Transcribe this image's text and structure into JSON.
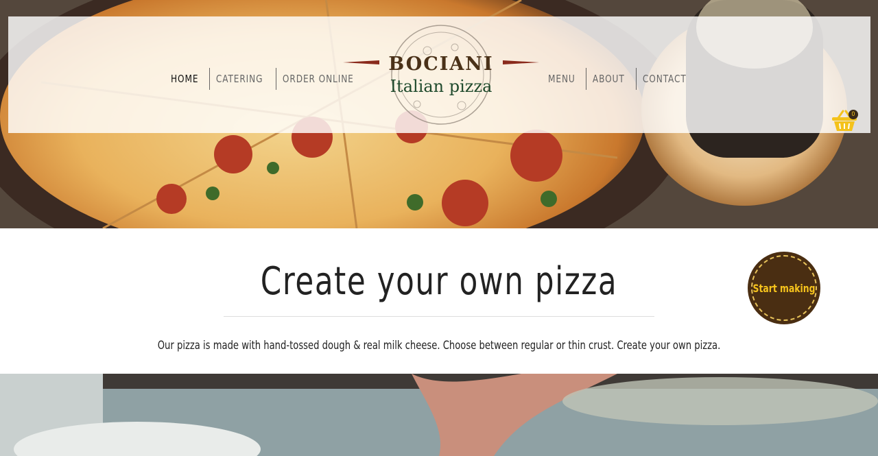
{
  "nav": {
    "left": [
      {
        "label": "HOME"
      },
      {
        "label": "CATERING"
      },
      {
        "label": "ORDER ONLINE"
      }
    ],
    "right": [
      {
        "label": "MENU"
      },
      {
        "label": "ABOUT"
      },
      {
        "label": "CONTACT"
      }
    ]
  },
  "logo": {
    "brand": "BOCIANI",
    "subtitle": "Italian pizza"
  },
  "cart": {
    "count": "0",
    "icon": "basket-icon",
    "color": "#f4c21b"
  },
  "intro": {
    "title": "Create your own pizza",
    "text": "Our pizza is made with hand-tossed dough & real milk cheese. Choose between regular or thin crust. Create your own pizza.",
    "cta": "Start making"
  },
  "colors": {
    "brand_brown": "#4a3118",
    "brand_green": "#1f4a2c",
    "cta_bg": "#4a2e12",
    "cta_text": "#f6c31c"
  }
}
